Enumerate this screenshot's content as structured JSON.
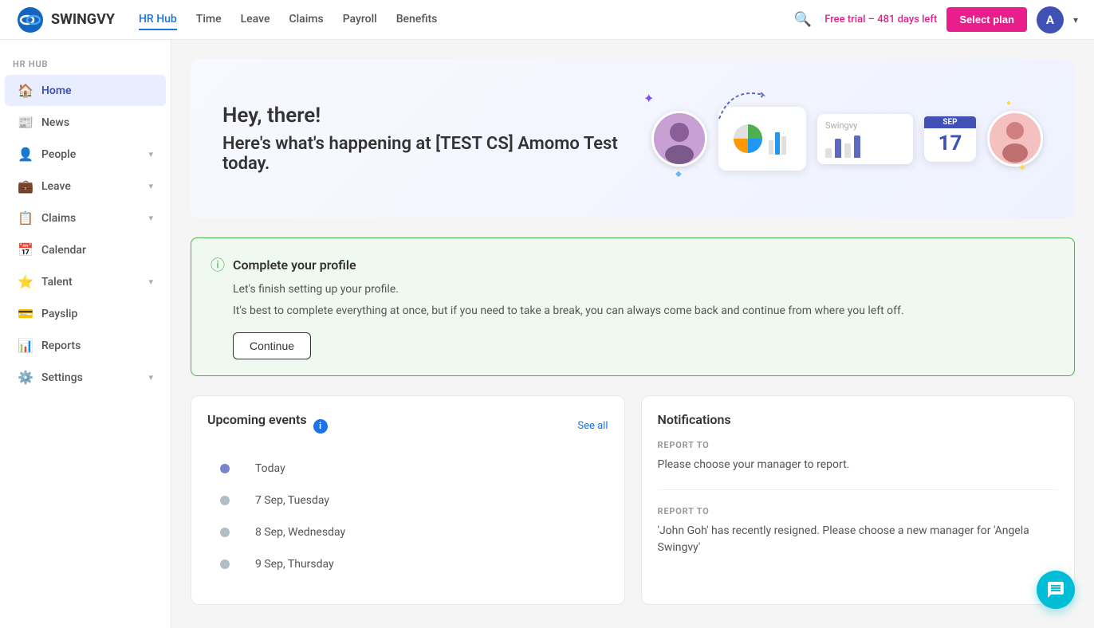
{
  "app": {
    "name": "SWINGVY"
  },
  "topnav": {
    "links": [
      {
        "label": "HR Hub",
        "active": true
      },
      {
        "label": "Time",
        "active": false
      },
      {
        "label": "Leave",
        "active": false
      },
      {
        "label": "Claims",
        "active": false
      },
      {
        "label": "Payroll",
        "active": false
      },
      {
        "label": "Benefits",
        "active": false
      }
    ],
    "trial_text": "Free trial – 481 days left",
    "select_plan": "Select plan",
    "avatar_letter": "A"
  },
  "sidebar": {
    "section_label": "HR HUB",
    "items": [
      {
        "label": "Home",
        "icon": "🏠",
        "active": true,
        "has_chevron": false
      },
      {
        "label": "News",
        "icon": "📰",
        "active": false,
        "has_chevron": false
      },
      {
        "label": "People",
        "icon": "👤",
        "active": false,
        "has_chevron": true
      },
      {
        "label": "Leave",
        "icon": "💼",
        "active": false,
        "has_chevron": true
      },
      {
        "label": "Claims",
        "icon": "📋",
        "active": false,
        "has_chevron": true
      },
      {
        "label": "Calendar",
        "icon": "📅",
        "active": false,
        "has_chevron": false
      },
      {
        "label": "Talent",
        "icon": "⭐",
        "active": false,
        "has_chevron": true
      },
      {
        "label": "Payslip",
        "icon": "💳",
        "active": false,
        "has_chevron": false
      },
      {
        "label": "Reports",
        "icon": "📊",
        "active": false,
        "has_chevron": false
      },
      {
        "label": "Settings",
        "icon": "⚙️",
        "active": false,
        "has_chevron": true
      }
    ]
  },
  "hero": {
    "greeting": "Hey, there!",
    "subtitle": "Here's what's happening at [TEST CS] Amomo Test today."
  },
  "profile_banner": {
    "title": "Complete your profile",
    "line1": "Let's finish setting up your profile.",
    "line2": "It's best to complete everything at once, but if you need to take a break, you can always come back and continue from where you left off.",
    "button_label": "Continue"
  },
  "upcoming_events": {
    "section_title": "Upcoming events",
    "see_all": "See all",
    "items": [
      {
        "date": "Today",
        "is_today": true
      },
      {
        "date": "7 Sep, Tuesday",
        "is_today": false
      },
      {
        "date": "8 Sep, Wednesday",
        "is_today": false
      },
      {
        "date": "9 Sep, Thursday",
        "is_today": false
      }
    ]
  },
  "notifications": {
    "section_title": "Notifications",
    "items": [
      {
        "label": "REPORT TO",
        "text": "Please choose your manager to report."
      },
      {
        "label": "REPORT TO",
        "text": "'John Goh' has recently resigned. Please choose a new manager for 'Angela Swingvy'"
      }
    ]
  },
  "calendar_date": "17",
  "chat_icon": "💬"
}
